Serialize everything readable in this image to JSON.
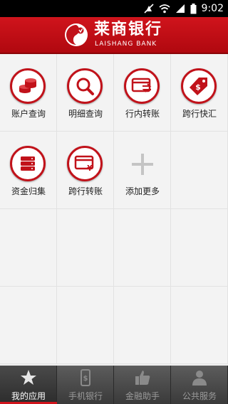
{
  "status_bar": {
    "time": "9:02"
  },
  "header": {
    "brand_cn": "莱商银行",
    "brand_en": "LAISHANG BANK"
  },
  "tiles": [
    {
      "label": "账户查询",
      "icon": "coins-icon"
    },
    {
      "label": "明细查询",
      "icon": "magnifier-icon"
    },
    {
      "label": "行内转账",
      "icon": "transfer-card-icon"
    },
    {
      "label": "跨行快汇",
      "icon": "price-tag-icon"
    },
    {
      "label": "资金归集",
      "icon": "server-stack-icon"
    },
    {
      "label": "跨行转账",
      "icon": "yuan-card-icon"
    },
    {
      "label": "添加更多",
      "icon": "plus-icon"
    }
  ],
  "tabs": [
    {
      "label": "我的应用",
      "icon": "star-icon",
      "active": true
    },
    {
      "label": "手机银行",
      "icon": "phone-icon",
      "active": false
    },
    {
      "label": "金融助手",
      "icon": "thumbs-up-icon",
      "active": false
    },
    {
      "label": "公共服务",
      "icon": "person-icon",
      "active": false
    }
  ],
  "colors": {
    "brand_red": "#c1121a",
    "header_red": "#d0141c"
  }
}
